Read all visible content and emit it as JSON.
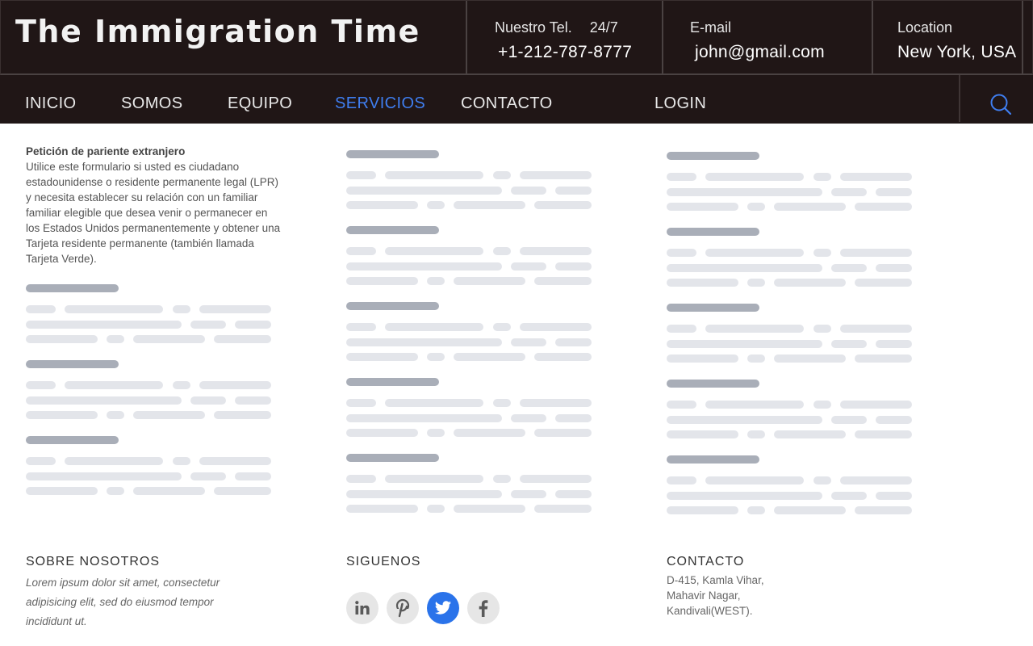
{
  "header": {
    "brand": "The Immigration Time",
    "phone_label": "Nuestro Tel.",
    "phone_hours": "24/7",
    "phone_value": "+1-212-787-8777",
    "email_label": "E-mail",
    "email_value": "john@gmail.com",
    "location_label": "Location",
    "location_value": "New York, USA"
  },
  "nav": {
    "items": [
      "INICIO",
      "SOMOS",
      "EQUIPO",
      "SERVICIOS",
      "CONTACTO",
      "LOGIN"
    ],
    "active": "SERVICIOS",
    "search_icon": "search-icon"
  },
  "intro": {
    "title": "Petición de pariente extranjero",
    "body": "Utilice este formulario si usted es ciudadano estadounidense o residente permanente legal (LPR) y necesita establecer su relación con un familiar familiar elegible que desea venir o permanecer en los Estados Unidos permanentemente y obtener una Tarjeta residente permanente (también llamada Tarjeta Verde)."
  },
  "footer": {
    "about_title": "SOBRE NOSOTROS",
    "about_text": "Lorem ipsum dolor sit amet, consectetur adipisicing elit, sed do eiusmod tempor incididunt ut.",
    "follow_title": "SIGUENOS",
    "social": [
      "linkedin-icon",
      "pinterest-icon",
      "twitter-icon",
      "facebook-icon"
    ],
    "social_active": "twitter-icon",
    "contact_title": "CONTACTO",
    "contact_address": "D-415, Kamla Vihar, Mahavir Nagar, Kandivali(WEST)."
  },
  "colors": {
    "header_bg": "#201616",
    "accent": "#3f7ef0",
    "social_active": "#2a73ea",
    "skeleton_title": "#a9aeb8",
    "skeleton_line": "#e3e5ea"
  }
}
